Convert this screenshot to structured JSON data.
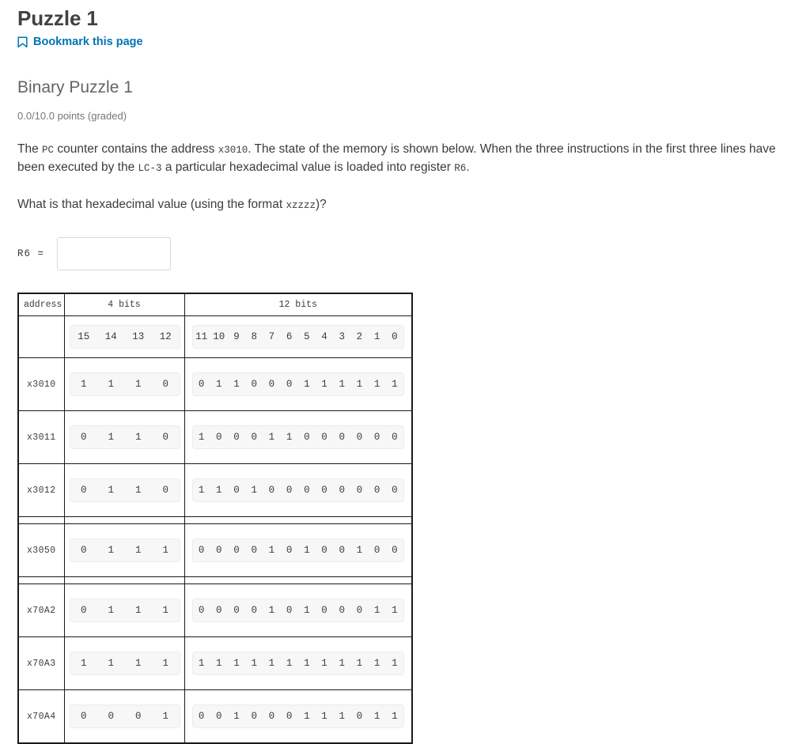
{
  "header": {
    "unit_title": "Puzzle 1",
    "bookmark_label": "Bookmark this page",
    "bookmark_icon": "bookmark-icon",
    "link_color": "#0075b4"
  },
  "problem": {
    "title": "Binary Puzzle 1",
    "points": "0.0/10.0 points (graded)",
    "paragraph1_part1": "The ",
    "paragraph1_code1": "PC",
    "paragraph1_part2": " counter contains the address ",
    "paragraph1_code2": "x3010",
    "paragraph1_part3": ". The state of the memory is shown below. When the three instructions in the first three lines have been executed by the ",
    "paragraph1_code3": "LC-3",
    "paragraph1_part4": " a particular hexadecimal value is loaded into register ",
    "paragraph1_code4": "R6",
    "paragraph1_part5": ".",
    "paragraph2_part1": "What is that hexadecimal value (using the format ",
    "paragraph2_code1": "xzzzz",
    "paragraph2_part2": ")?"
  },
  "answer": {
    "label": "R6 =",
    "value": "",
    "placeholder": ""
  },
  "memory_table": {
    "headers": {
      "address": "address",
      "high": "4 bits",
      "low": "12 bits"
    },
    "bit_numbers_high": [
      "15",
      "14",
      "13",
      "12"
    ],
    "bit_numbers_low": [
      "11",
      "10",
      "9",
      "8",
      "7",
      "6",
      "5",
      "4",
      "3",
      "2",
      "1",
      "0"
    ],
    "rows": [
      {
        "address": "x3010",
        "high": [
          "1",
          "1",
          "1",
          "0"
        ],
        "low": [
          "0",
          "1",
          "1",
          "0",
          "0",
          "0",
          "1",
          "1",
          "1",
          "1",
          "1",
          "1"
        ],
        "spacer_after": false
      },
      {
        "address": "x3011",
        "high": [
          "0",
          "1",
          "1",
          "0"
        ],
        "low": [
          "1",
          "0",
          "0",
          "0",
          "1",
          "1",
          "0",
          "0",
          "0",
          "0",
          "0",
          "0"
        ],
        "spacer_after": false
      },
      {
        "address": "x3012",
        "high": [
          "0",
          "1",
          "1",
          "0"
        ],
        "low": [
          "1",
          "1",
          "0",
          "1",
          "0",
          "0",
          "0",
          "0",
          "0",
          "0",
          "0",
          "0"
        ],
        "spacer_after": true
      },
      {
        "address": "x3050",
        "high": [
          "0",
          "1",
          "1",
          "1"
        ],
        "low": [
          "0",
          "0",
          "0",
          "0",
          "1",
          "0",
          "1",
          "0",
          "0",
          "1",
          "0",
          "0"
        ],
        "spacer_after": true
      },
      {
        "address": "x70A2",
        "high": [
          "0",
          "1",
          "1",
          "1"
        ],
        "low": [
          "0",
          "0",
          "0",
          "0",
          "1",
          "0",
          "1",
          "0",
          "0",
          "0",
          "1",
          "1"
        ],
        "spacer_after": false
      },
      {
        "address": "x70A3",
        "high": [
          "1",
          "1",
          "1",
          "1"
        ],
        "low": [
          "1",
          "1",
          "1",
          "1",
          "1",
          "1",
          "1",
          "1",
          "1",
          "1",
          "1",
          "1"
        ],
        "spacer_after": false
      },
      {
        "address": "x70A4",
        "high": [
          "0",
          "0",
          "0",
          "1"
        ],
        "low": [
          "0",
          "0",
          "1",
          "0",
          "0",
          "0",
          "1",
          "1",
          "1",
          "0",
          "1",
          "1"
        ],
        "spacer_after": false
      }
    ]
  }
}
